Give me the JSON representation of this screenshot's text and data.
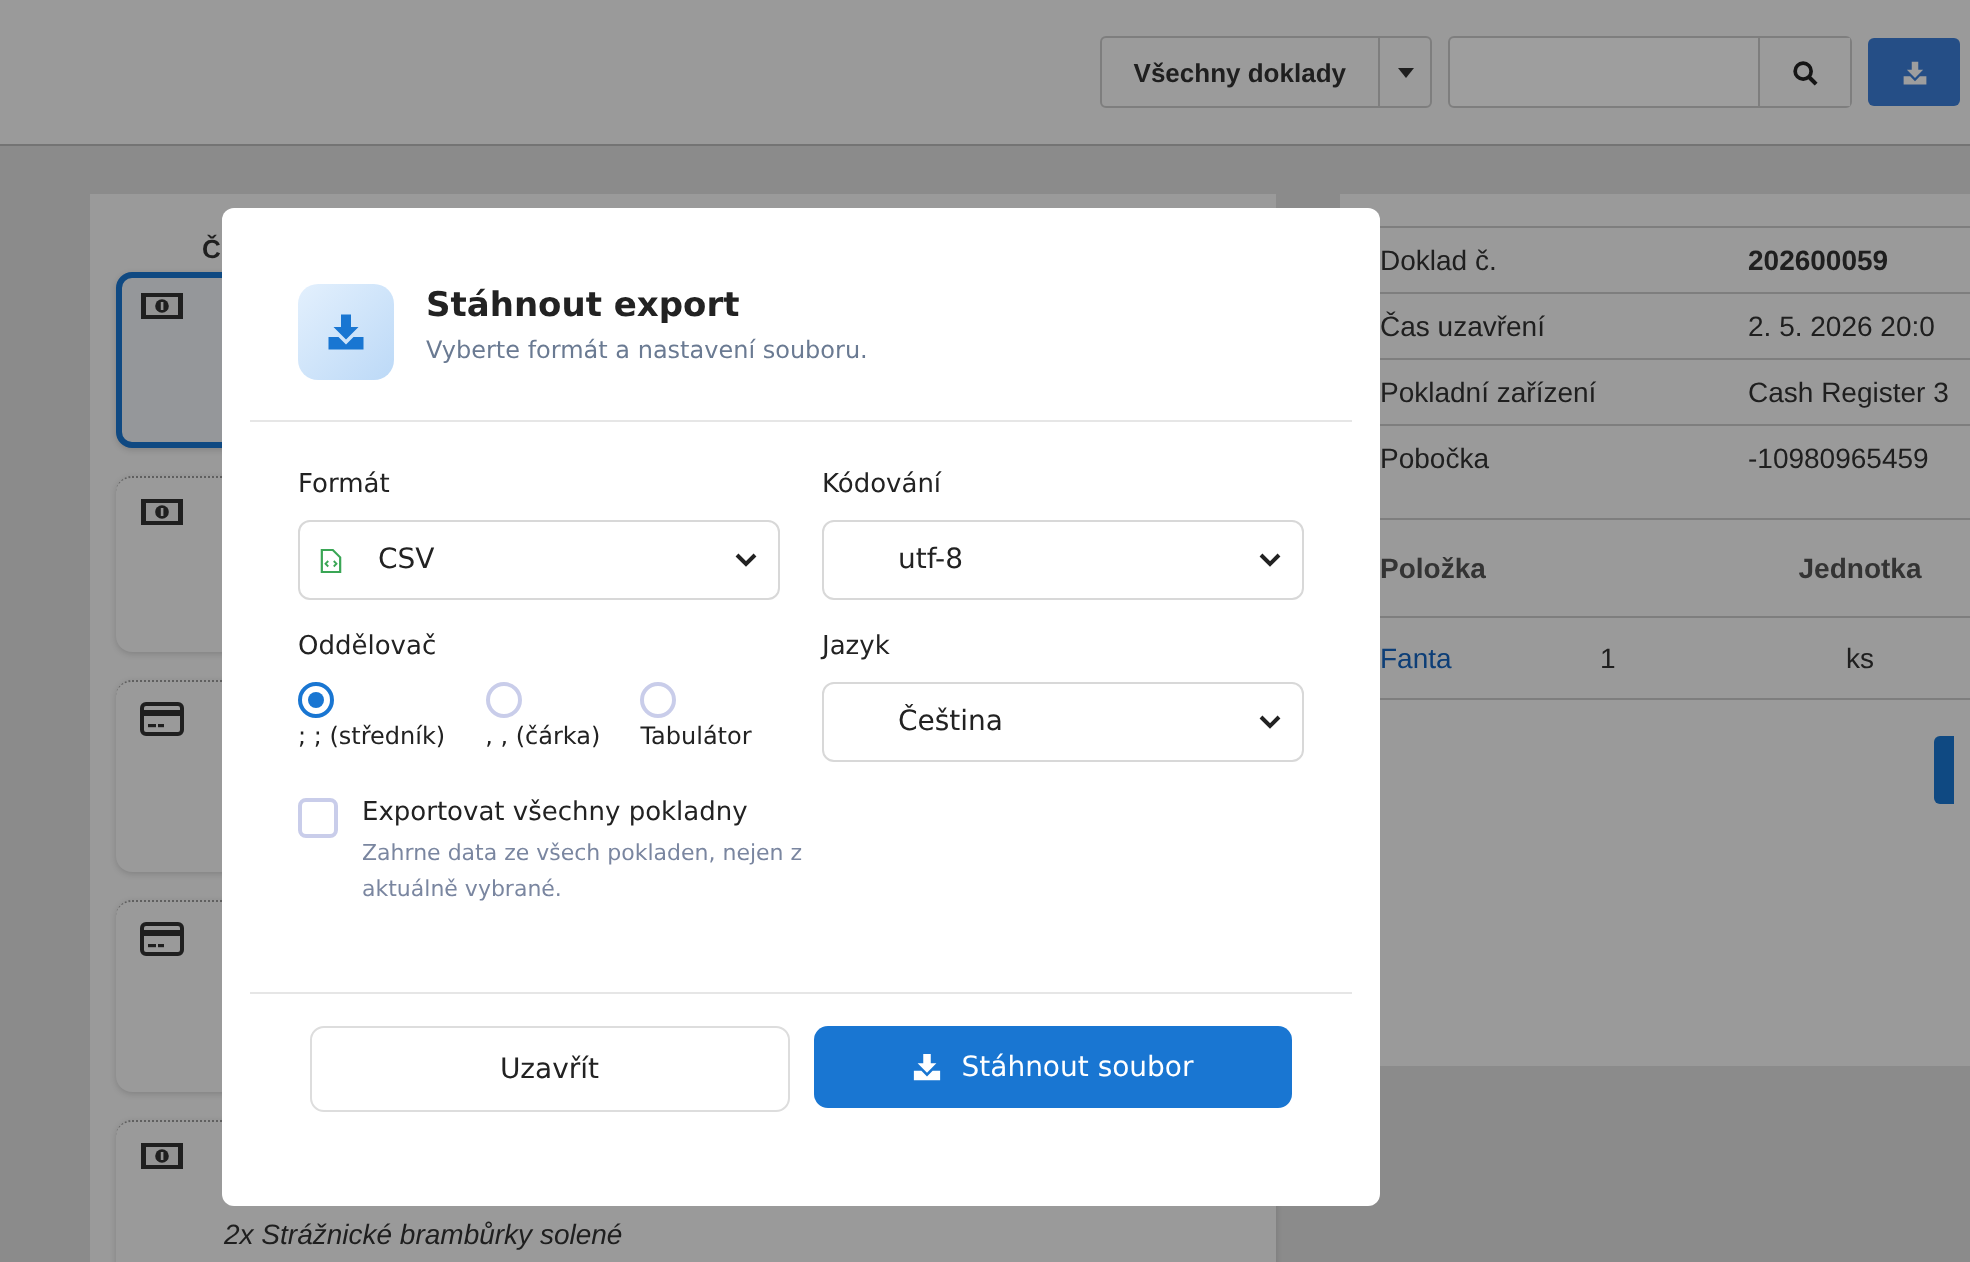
{
  "toolbar": {
    "filter": "Všechny doklady"
  },
  "receipt_list": {
    "header": "Č",
    "cards": [
      {
        "kind": "cash",
        "selected": true
      },
      {
        "kind": "cash",
        "selected": false
      },
      {
        "kind": "card",
        "selected": false
      },
      {
        "kind": "card",
        "selected": false
      },
      {
        "kind": "cash",
        "selected": false,
        "note": "2x Strážnické brambůrky solené"
      }
    ]
  },
  "detail": {
    "rows": [
      {
        "label": "Doklad č.",
        "value": "202600059"
      },
      {
        "label": "Čas uzavření",
        "value": "2. 5. 2026 20:0"
      },
      {
        "label": "Pokladní zařízení",
        "value": "Cash Register 3"
      },
      {
        "label": "Pobočka",
        "value": "-10980965459"
      }
    ],
    "items": {
      "columns": [
        "Položka",
        "Jednotka"
      ],
      "rows": [
        {
          "name": "Fanta",
          "quantity": "1",
          "unit": "ks"
        }
      ]
    }
  },
  "export_dialog": {
    "title": "Stáhnout export",
    "subtitle": "Vyberte formát a nastavení souboru.",
    "format": {
      "label": "Formát",
      "value": "CSV"
    },
    "encoding": {
      "label": "Kódování",
      "value": "utf-8"
    },
    "separator": {
      "label": "Oddělovač",
      "options": [
        {
          "label": "; ; (středník)",
          "selected": true
        },
        {
          "label": ", , (čárka)",
          "selected": false
        },
        {
          "label": "Tabulátor",
          "selected": false
        }
      ]
    },
    "language": {
      "label": "Jazyk",
      "value": "Čeština"
    },
    "export_all": {
      "label": "Exportovat všechny pokladny",
      "checked": false,
      "help": "Zahrne data ze všech pokladen, nejen z aktuálně vybrané."
    },
    "buttons": {
      "close": "Uzavřít",
      "download": "Stáhnout soubor"
    }
  }
}
